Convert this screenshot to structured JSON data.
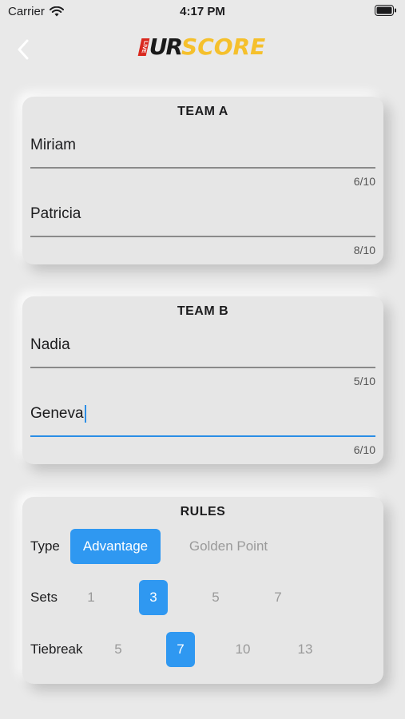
{
  "status_bar": {
    "carrier": "Carrier",
    "time": "4:17 PM"
  },
  "header": {
    "logo_badge": "LIVE",
    "logo_ur": "UR",
    "logo_score": "SCORE"
  },
  "team_a": {
    "title": "TEAM A",
    "players": [
      {
        "name": "Miriam",
        "counter": "6/10"
      },
      {
        "name": "Patricia",
        "counter": "8/10"
      }
    ]
  },
  "team_b": {
    "title": "TEAM B",
    "players": [
      {
        "name": "Nadia",
        "counter": "5/10"
      },
      {
        "name": "Geneva",
        "counter": "6/10"
      }
    ]
  },
  "rules": {
    "title": "RULES",
    "type": {
      "label": "Type",
      "options": [
        "Advantage",
        "Golden Point"
      ],
      "selected": "Advantage"
    },
    "sets": {
      "label": "Sets",
      "options": [
        "1",
        "3",
        "5",
        "7"
      ],
      "selected": "3"
    },
    "tiebreak": {
      "label": "Tiebreak",
      "options": [
        "5",
        "7",
        "10",
        "13"
      ],
      "selected": "7"
    }
  },
  "colors": {
    "accent": "#2f98f1",
    "logo_yellow": "#f5c02c",
    "logo_red": "#d9281e",
    "background": "#e9e9e9"
  }
}
